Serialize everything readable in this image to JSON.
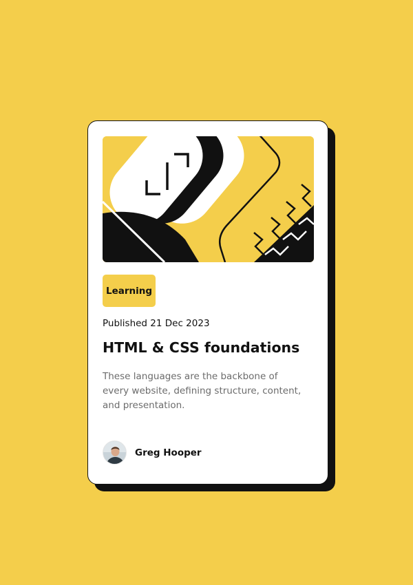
{
  "colors": {
    "background": "#F4CE4B",
    "card": "#FFFFFF",
    "ink": "#111111",
    "muted": "#6B6B6B"
  },
  "card": {
    "image_name": "hero-illustration",
    "tag": "Learning",
    "published": "Published 21 Dec 2023",
    "title": "HTML & CSS foundations",
    "description": "These languages are the backbone of every website, defining structure, content, and presentation.",
    "author": {
      "name": "Greg Hooper",
      "avatar_name": "avatar"
    }
  }
}
